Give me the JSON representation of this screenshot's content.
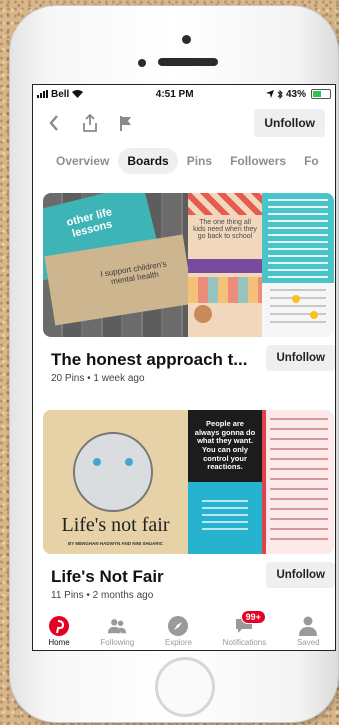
{
  "status_bar": {
    "carrier": "Bell",
    "time": "4:51 PM",
    "battery": "43%"
  },
  "toolbar": {
    "unfollow_label": "Unfollow"
  },
  "tabs": [
    {
      "label": "Overview"
    },
    {
      "label": "Boards"
    },
    {
      "label": "Pins"
    },
    {
      "label": "Followers"
    },
    {
      "label": "Fo"
    }
  ],
  "boards": [
    {
      "title": "The honest approach t...",
      "meta": "20 Pins • 1 week ago",
      "unfollow_label": "Unfollow",
      "collage_text": {
        "card_a": "other life lessons",
        "card_b": "I support children's mental health",
        "card_c": "The one thing all kids need when they go back to school"
      }
    },
    {
      "title": "Life's Not Fair",
      "meta": "11 Pins • 2 months ago",
      "unfollow_label": "Unfollow",
      "collage_text": {
        "book_title": "Life's not fair",
        "book_authors": "BY MENGHAN HADWYN AND NINI SHUARIC",
        "quote": "People are always gonna do what they want. You can only control your reactions."
      }
    }
  ],
  "bottom_nav": [
    {
      "label": "Home",
      "icon": "pinterest-icon"
    },
    {
      "label": "Following",
      "icon": "people-icon"
    },
    {
      "label": "Explore",
      "icon": "compass-icon"
    },
    {
      "label": "Notifications",
      "icon": "speech-bubble-icon",
      "badge": "99+"
    },
    {
      "label": "Saved",
      "icon": "person-icon"
    }
  ],
  "colors": {
    "accent": "#e60023",
    "active_tab_bg": "#efefef",
    "battery": "#33c14a"
  }
}
